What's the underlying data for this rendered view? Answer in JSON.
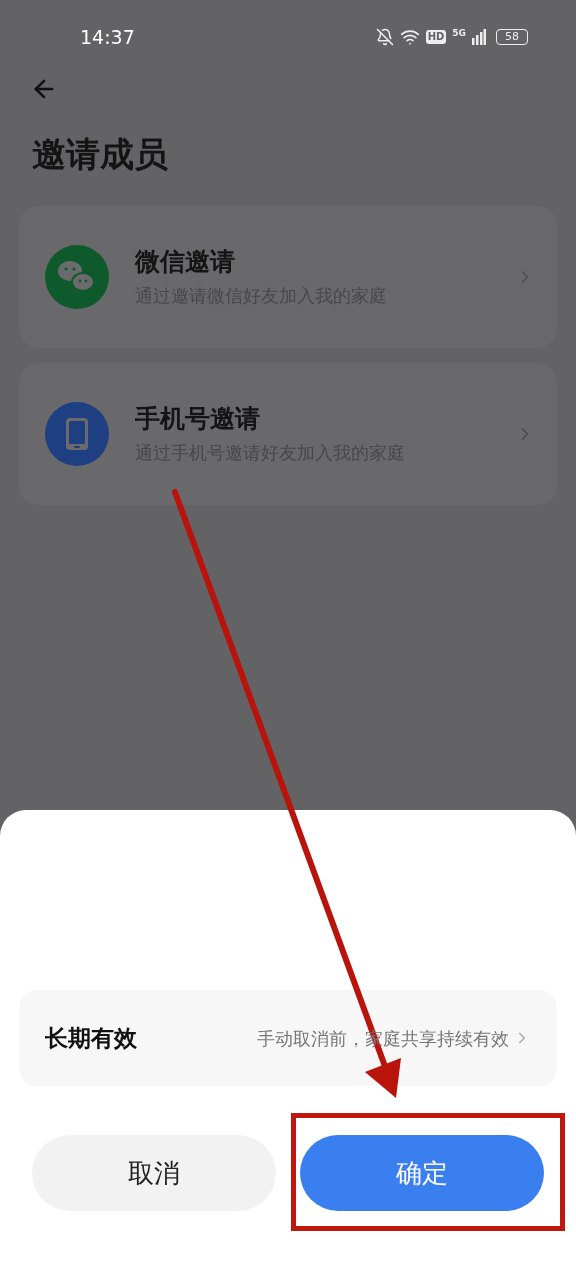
{
  "status_bar": {
    "time": "14:37",
    "hd": "HD",
    "network": "5G",
    "battery": "58"
  },
  "header": {
    "title": "邀请成员"
  },
  "invite_options": [
    {
      "kind": "wechat",
      "title": "微信邀请",
      "subtitle": "通过邀请微信好友加入我的家庭"
    },
    {
      "kind": "phone",
      "title": "手机号邀请",
      "subtitle": "通过手机号邀请好友加入我的家庭"
    }
  ],
  "sheet": {
    "validity": {
      "label": "长期有效",
      "value": "手动取消前，家庭共享持续有效"
    },
    "buttons": [
      {
        "kind": "secondary",
        "label": "取消"
      },
      {
        "kind": "primary",
        "label": "确定"
      }
    ]
  }
}
